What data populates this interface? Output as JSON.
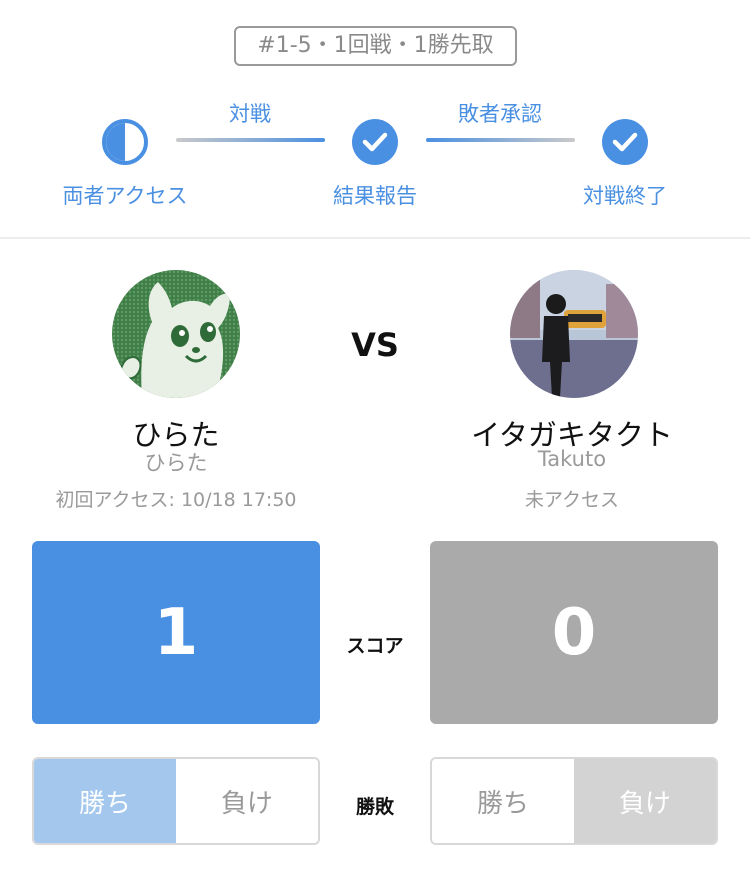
{
  "match": {
    "badge": "#1-5・1回戦・1勝先取"
  },
  "steps": {
    "items": [
      {
        "label": "両者アクセス",
        "state": "half",
        "icon": "half-circle-icon"
      },
      {
        "label": "結果報告",
        "state": "done",
        "icon": "check-circle-icon"
      },
      {
        "label": "対戦終了",
        "state": "done",
        "icon": "check-circle-icon"
      }
    ],
    "connectors": [
      "対戦",
      "敗者承認"
    ]
  },
  "vs_label": "VS",
  "players": {
    "left": {
      "name": "ひらた",
      "handle": "ひらた",
      "access": "初回アクセス: 10/18 17:50",
      "score": "1",
      "result": "win"
    },
    "right": {
      "name": "イタガキタクト",
      "handle": "Takuto",
      "access": "未アクセス",
      "score": "0",
      "result": "lose"
    }
  },
  "labels": {
    "score": "スコア",
    "result": "勝敗",
    "win": "勝ち",
    "lose": "負け"
  },
  "colors": {
    "accent": "#4a90e2",
    "inactive": "#aaaaaa",
    "win_light": "#a4c7ee",
    "lose_light": "#d3d3d3"
  }
}
